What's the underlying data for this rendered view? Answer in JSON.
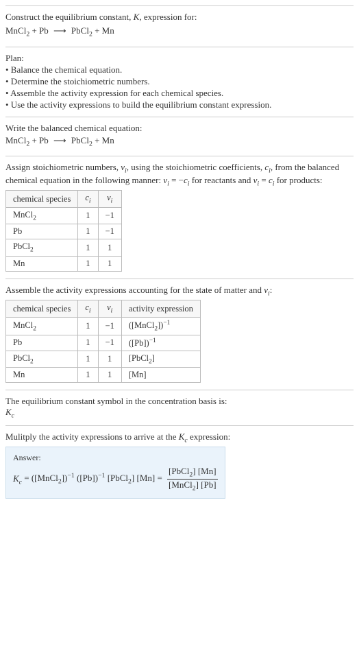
{
  "header": {
    "title_line1": "Construct the equilibrium constant, K, expression for:",
    "equation": "MnCl₂ + Pb ⟶ PbCl₂ + Mn"
  },
  "plan": {
    "title": "Plan:",
    "items": [
      "• Balance the chemical equation.",
      "• Determine the stoichiometric numbers.",
      "• Assemble the activity expression for each chemical species.",
      "• Use the activity expressions to build the equilibrium constant expression."
    ]
  },
  "balanced": {
    "title": "Write the balanced chemical equation:",
    "equation": "MnCl₂ + Pb ⟶ PbCl₂ + Mn"
  },
  "stoich": {
    "intro": "Assign stoichiometric numbers, νᵢ, using the stoichiometric coefficients, cᵢ, from the balanced chemical equation in the following manner: νᵢ = −cᵢ for reactants and νᵢ = cᵢ for products:",
    "headers": [
      "chemical species",
      "cᵢ",
      "νᵢ"
    ],
    "rows": [
      [
        "MnCl₂",
        "1",
        "−1"
      ],
      [
        "Pb",
        "1",
        "−1"
      ],
      [
        "PbCl₂",
        "1",
        "1"
      ],
      [
        "Mn",
        "1",
        "1"
      ]
    ]
  },
  "activity": {
    "intro": "Assemble the activity expressions accounting for the state of matter and νᵢ:",
    "headers": [
      "chemical species",
      "cᵢ",
      "νᵢ",
      "activity expression"
    ],
    "rows": [
      [
        "MnCl₂",
        "1",
        "−1",
        "([MnCl₂])⁻¹"
      ],
      [
        "Pb",
        "1",
        "−1",
        "([Pb])⁻¹"
      ],
      [
        "PbCl₂",
        "1",
        "1",
        "[PbCl₂]"
      ],
      [
        "Mn",
        "1",
        "1",
        "[Mn]"
      ]
    ]
  },
  "symbol": {
    "line1": "The equilibrium constant symbol in the concentration basis is:",
    "line2": "K_c"
  },
  "multiply": {
    "intro": "Mulitply the activity expressions to arrive at the K_c expression:"
  },
  "answer": {
    "label": "Answer:",
    "lhs": "K_c = ([MnCl₂])⁻¹ ([Pb])⁻¹ [PbCl₂] [Mn] =",
    "frac_num": "[PbCl₂] [Mn]",
    "frac_den": "[MnCl₂] [Pb]"
  }
}
